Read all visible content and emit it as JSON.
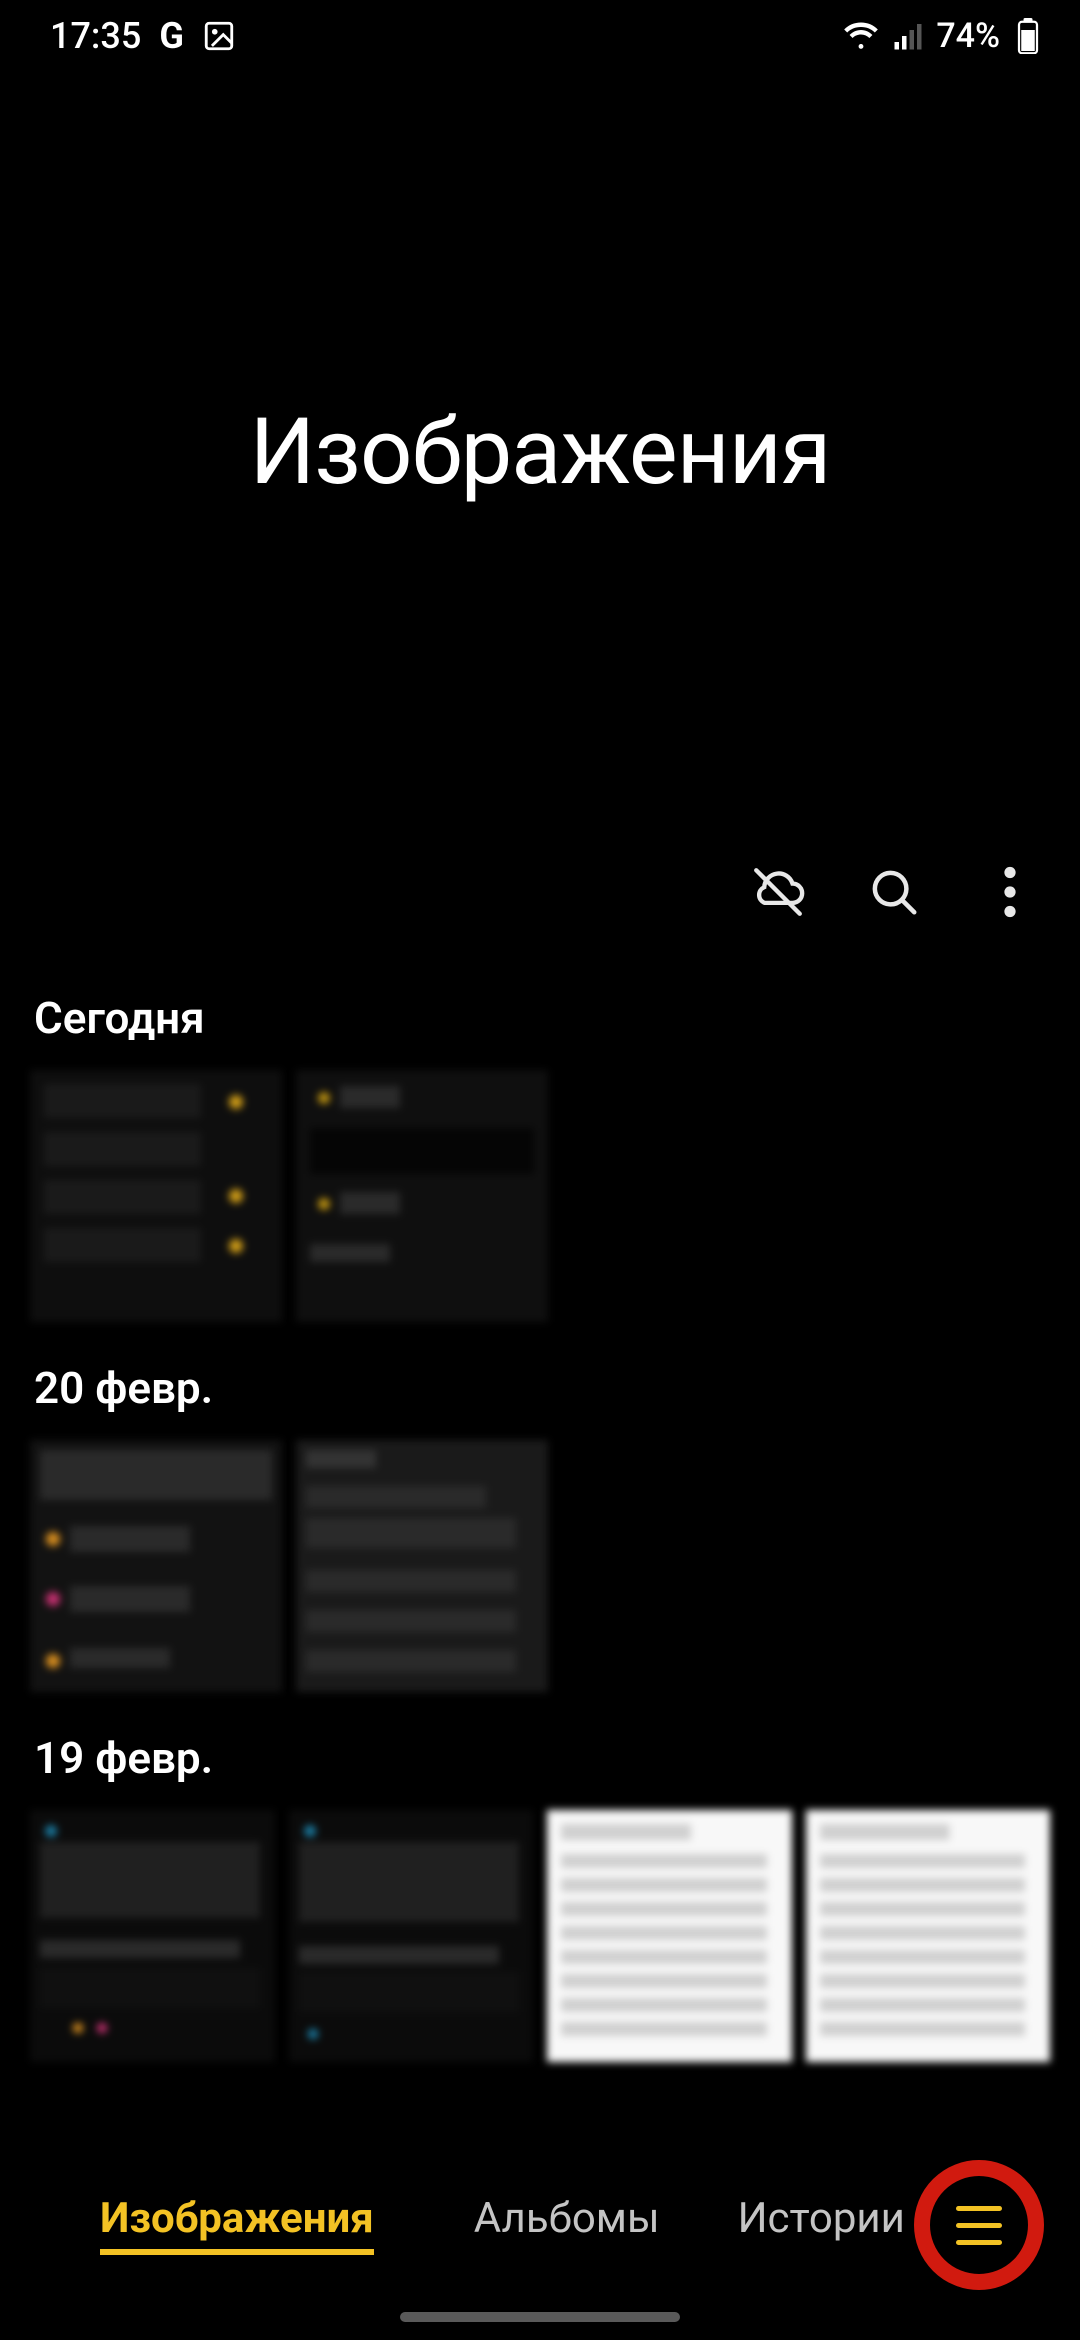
{
  "status_bar": {
    "time": "17:35",
    "battery_percent": "74%"
  },
  "header": {
    "title": "Изображения"
  },
  "sections": [
    {
      "title": "Сегодня"
    },
    {
      "title": "20 февр."
    },
    {
      "title": "19 февр."
    }
  ],
  "tabs": {
    "images": "Изображения",
    "albums": "Альбомы",
    "stories": "Истории"
  },
  "colors": {
    "accent": "#f3c224",
    "highlight_ring": "#d11a0f"
  }
}
